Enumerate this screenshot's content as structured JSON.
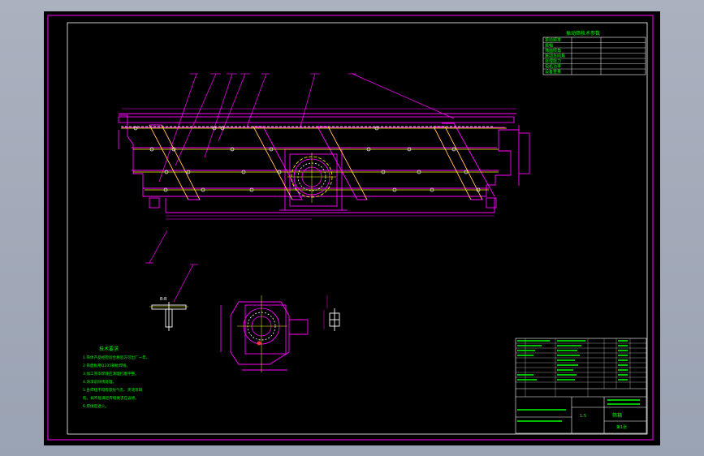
{
  "colors": {
    "background": "#000000",
    "frame": "#ff00ff",
    "outline": "#ff00ff",
    "centerline": "#ffff00",
    "text": "#00ff00",
    "white": "#ffffff",
    "red": "#ff3030",
    "cyan": "#00ffff",
    "viewport": "#a9b0bd"
  },
  "tech_params": {
    "title": "振动筛技术参数",
    "rows": [
      "振动频率",
      "振幅",
      "筛面倾角",
      "振动方向角",
      "处理能力",
      "电机功率",
      "设备重量"
    ],
    "values": [
      "",
      "",
      "",
      "",
      "",
      "",
      ""
    ]
  },
  "notes": {
    "title": "技术要求",
    "lines": [
      "1.筛体产品经检验合格后方可出厂一年。",
      "2.筛面板用Q235钢板焊接。",
      "3.加工完毕焊缝应清理打磨平整。",
      "4.涂漆前除锈处理。",
      "5.各焊缝不得有裂纹气孔、夹渣等缺",
      "  陷，如不能满足焊缝要求应返修。",
      "6.焊接后退火。"
    ]
  },
  "detail_label": "B-B",
  "title_block": {
    "name": "筛箱",
    "scale": "1:5",
    "sheet": "第1张"
  }
}
